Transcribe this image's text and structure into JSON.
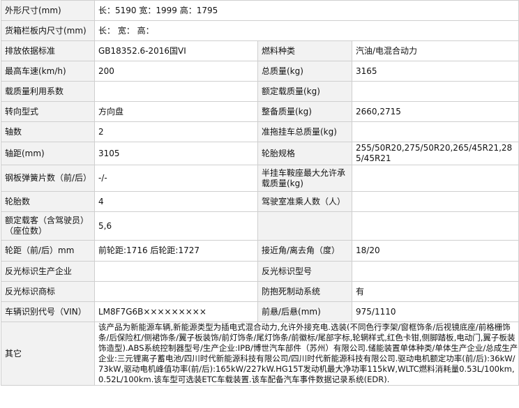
{
  "rows": [
    {
      "type": "full",
      "label": "外形尺寸(mm)",
      "value": "长：5190 宽：1999 高：1795"
    },
    {
      "type": "full",
      "label": "货箱栏板内尺寸(mm)",
      "value": "长： 宽： 高："
    },
    {
      "type": "pair",
      "label1": "排放依据标准",
      "value1": "GB18352.6-2016国VI",
      "label2": "燃料种类",
      "value2": "汽油/电混合动力"
    },
    {
      "type": "pair",
      "label1": "最高车速(km/h)",
      "value1": "200",
      "label2": "总质量(kg)",
      "value2": "3165"
    },
    {
      "type": "pair",
      "label1": "载质量利用系数",
      "value1": "",
      "label2": "额定载质量(kg)",
      "value2": ""
    },
    {
      "type": "pair",
      "label1": "转向型式",
      "value1": "方向盘",
      "label2": "整备质量(kg)",
      "value2": "2660,2715"
    },
    {
      "type": "pair",
      "label1": "轴数",
      "value1": "2",
      "label2": "准拖挂车总质量(kg)",
      "value2": ""
    },
    {
      "type": "pair",
      "label1": "轴距(mm)",
      "value1": "3105",
      "label2": "轮胎规格",
      "value2": "255/50R20,275/50R20,265/45R21,285/45R21"
    },
    {
      "type": "pair",
      "label1": "钢板弹簧片数（前/后）",
      "value1": "-/-",
      "label2": "半挂车鞍座最大允许承载质量(kg)",
      "value2": ""
    },
    {
      "type": "pair",
      "label1": "轮胎数",
      "value1": "4",
      "label2": "驾驶室准乘人数（人）",
      "value2": ""
    },
    {
      "type": "pair",
      "label1": "额定载客（含驾驶员）（座位数）",
      "value1": "5,6",
      "label2": "",
      "value2": ""
    },
    {
      "type": "pair",
      "label1": "轮距（前/后）mm",
      "value1": "前轮距:1716 后轮距:1727",
      "label2": "接近角/离去角（度）",
      "value2": "18/20"
    },
    {
      "type": "pair",
      "label1": "反光标识生产企业",
      "value1": "",
      "label2": "反光标识型号",
      "value2": ""
    },
    {
      "type": "pair",
      "label1": "反光标识商标",
      "value1": "",
      "label2": "防抱死制动系统",
      "value2": "有"
    },
    {
      "type": "pair",
      "label1": "车辆识别代号（VIN）",
      "value1": "LM8F7G6B×××××××××",
      "label2": "前悬/后悬(mm)",
      "value2": "975/1110"
    },
    {
      "type": "full",
      "label": "其它",
      "value": "该产品为新能源车辆,新能源类型为插电式混合动力,允许外接充电.选装(不同色行李架/窗框饰条/后视镜底座/前格栅饰条/后保险杠/侧裙饰条/翼子板装饰/前灯饰条/尾灯饰条/前徽标/尾部字标,轮辋样式,红色卡钳,侧脚踏板,电动门,翼子板装饰造型).ABS系统控制器型号/生产企业:IPB/博世汽车部件（苏州）有限公司.储能装置单体种类/单体生产企业/总成生产企业:三元锂离子蓄电池/四川时代新能源科技有限公司/四川时代新能源科技有限公司.驱动电机额定功率(前/后):36kW/73kW,驱动电机峰值功率(前/后):165kW/227kW.HG15T发动机最大净功率115kW,WLTC燃料消耗量0.53L/100km,0.52L/100km.该车型可选装ETC车载装置.该车配备汽车事件数据记录系统(EDR)."
    }
  ]
}
